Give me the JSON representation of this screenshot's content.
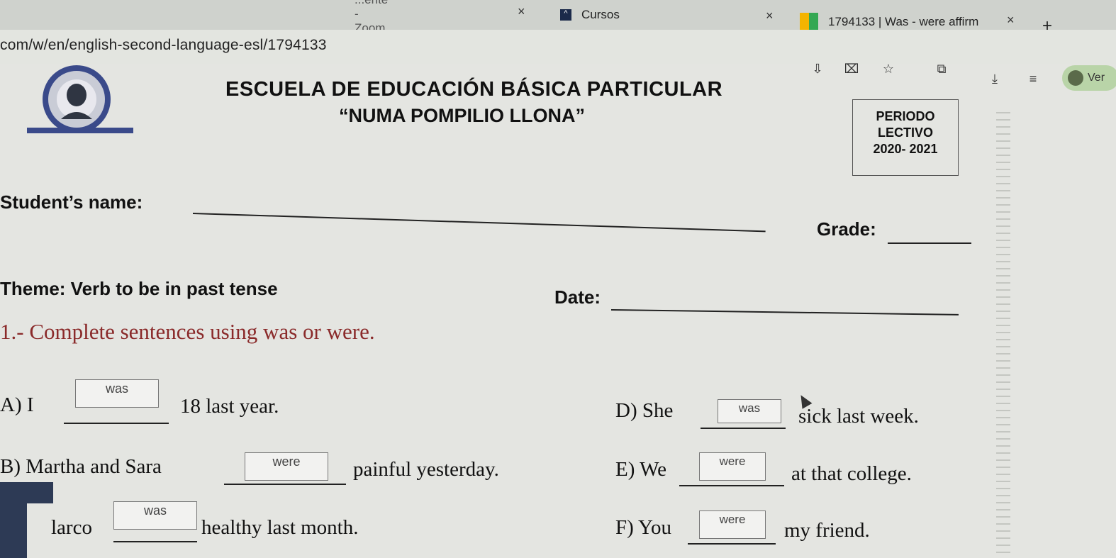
{
  "browser": {
    "tabs": [
      {
        "label": "...ente - Zoom"
      },
      {
        "label": "Cursos"
      },
      {
        "label": "1794133 | Was - were affirm"
      }
    ],
    "new_tab_label": "+",
    "close_label": "×",
    "url": "com/w/en/english-second-language-esl/1794133",
    "profile_label": "Ver"
  },
  "worksheet": {
    "school_name": "ESCUELA DE EDUCACIÓN BÁSICA PARTICULAR",
    "school_name2": "“NUMA POMPILIO LLONA”",
    "period_label1": "PERIODO",
    "period_label2": "LECTIVO",
    "period_years": "2020- 2021",
    "student_label": "Student’s name:",
    "grade_label": "Grade:",
    "theme": "Theme: Verb to be in past tense",
    "date_label": "Date:",
    "instruction": "1.- Complete sentences using was or were.",
    "sentences": [
      {
        "prefix": "A)  I",
        "answer": "was",
        "suffix": "18 last year."
      },
      {
        "prefix": "B) Martha and Sara",
        "answer": "were",
        "suffix": "painful yesterday."
      },
      {
        "prefix": "larco",
        "answer": "was",
        "suffix": "healthy last month."
      },
      {
        "prefix": "D)  She",
        "answer": "was",
        "suffix": "sick last week."
      },
      {
        "prefix": "E) We",
        "answer": "were",
        "suffix": "at that college."
      },
      {
        "prefix": "F) You",
        "answer": "were",
        "suffix": "my friend."
      }
    ]
  }
}
